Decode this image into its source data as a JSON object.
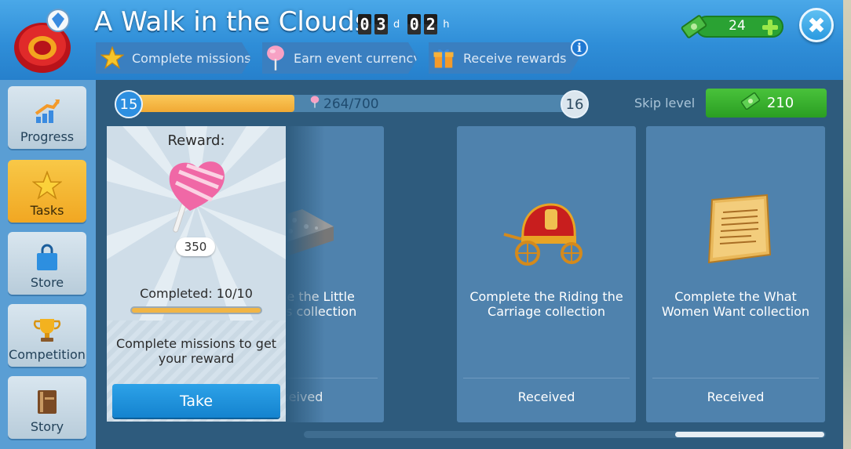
{
  "header": {
    "title": "A Walk in the Clouds",
    "timer": {
      "days": [
        "0",
        "3"
      ],
      "day_unit": "d",
      "hours": [
        "0",
        "2"
      ],
      "hour_unit": "h"
    },
    "steps": [
      {
        "label": "Complete missions",
        "icon": "star-icon"
      },
      {
        "label": "Earn event currency",
        "icon": "cotton-candy-icon"
      },
      {
        "label": "Receive rewards",
        "icon": "gift-icon"
      }
    ],
    "info_label": "i",
    "currency_value": "24",
    "close_label": "✖"
  },
  "sidebar": {
    "items": [
      {
        "label": "Progress",
        "icon": "progress-chart-icon",
        "active": false
      },
      {
        "label": "Tasks",
        "icon": "star-icon",
        "active": true
      },
      {
        "label": "Store",
        "icon": "shopping-bag-icon",
        "active": false
      },
      {
        "label": "Competition",
        "icon": "trophy-icon",
        "active": false
      },
      {
        "label": "Story",
        "icon": "book-icon",
        "active": false
      }
    ]
  },
  "progress": {
    "current_level": "15",
    "next_level": "16",
    "count_text": "264/700",
    "fraction": 0.377,
    "skip_label": "Skip level",
    "skip_cost": "210"
  },
  "reward": {
    "title": "Reward:",
    "amount": "350",
    "completed_text": "Completed: 10/10",
    "hint": "Complete missions to get your reward",
    "take_label": "Take"
  },
  "cards": [
    {
      "text": "Complete the Little Tragedies collection",
      "status": "Received",
      "art": "silver-box-icon"
    },
    {
      "text": "Complete the Riding the Carriage collection",
      "status": "Received",
      "art": "carriage-icon"
    },
    {
      "text": "Complete the What Women Want collection",
      "status": "Received",
      "art": "parchment-icon"
    }
  ],
  "colors": {
    "accent": "#2d8fe0",
    "active_tab": "#f1a722",
    "success": "#2aa233"
  }
}
